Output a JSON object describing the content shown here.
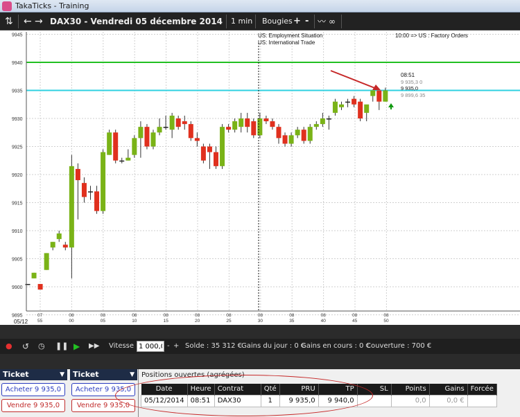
{
  "window": {
    "title": "TakaTicks - Training"
  },
  "toolbar": {
    "refresh_icon": "refresh-icon",
    "instrument_title": "DAX30 - Vendredi 05 décembre 2014",
    "timeframe": "1 min",
    "chart_type": "Bougies",
    "plus": "+",
    "minus": "-"
  },
  "chart": {
    "y_ticks": [
      "9945",
      "9940",
      "9935",
      "9930",
      "9925",
      "9920",
      "9915",
      "9910",
      "9905",
      "9900",
      "9895"
    ],
    "x_ticks": [
      {
        "top": "07",
        "bottom": "55"
      },
      {
        "top": "08",
        "bottom": "00"
      },
      {
        "top": "08",
        "bottom": "05"
      },
      {
        "top": "08",
        "bottom": "10"
      },
      {
        "top": "08",
        "bottom": "15"
      },
      {
        "top": "08",
        "bottom": "20"
      },
      {
        "top": "08",
        "bottom": "25"
      },
      {
        "top": "08",
        "bottom": "30"
      },
      {
        "top": "08",
        "bottom": "35"
      },
      {
        "top": "08",
        "bottom": "40"
      },
      {
        "top": "08",
        "bottom": "45"
      },
      {
        "top": "08",
        "bottom": "50"
      }
    ],
    "date_label": "05/12",
    "event_1": "US: Employment Situation",
    "event_2": "US: International Trade",
    "event_3": "10:00 => US : Factory Orders",
    "time_label": "08:51",
    "quote_1": "9 935,3   0",
    "quote_2": "9 935,0",
    "quote_3": "9 899,6   35"
  },
  "chart_data": {
    "type": "candlestick",
    "instrument": "DAX30",
    "ylim": [
      9895,
      9946
    ],
    "levels": [
      {
        "price": 9940,
        "color": "#22c022"
      },
      {
        "price": 9935,
        "color": "#2fd0e0"
      }
    ],
    "candles": [
      {
        "o": 9900.5,
        "h": 9900.5,
        "l": 9900.5,
        "c": 9900.5
      },
      {
        "o": 9901.5,
        "h": 9902.5,
        "l": 9901.5,
        "c": 9902.5
      },
      {
        "o": 9900.5,
        "h": 9900.5,
        "l": 9899.5,
        "c": 9899.5
      },
      {
        "o": 9903,
        "h": 9906,
        "l": 9903,
        "c": 9906
      },
      {
        "o": 9907,
        "h": 9908,
        "l": 9906.5,
        "c": 9908
      },
      {
        "o": 9908.5,
        "h": 9910,
        "l": 9908,
        "c": 9909.5
      },
      {
        "o": 9907.5,
        "h": 9908,
        "l": 9906.5,
        "c": 9907
      },
      {
        "o": 9907,
        "h": 9923.5,
        "l": 9901.5,
        "c": 9921.5
      },
      {
        "o": 9921,
        "h": 9922,
        "l": 9912,
        "c": 9919
      },
      {
        "o": 9918.5,
        "h": 9919.5,
        "l": 9915,
        "c": 9916
      },
      {
        "o": 9917,
        "h": 9918,
        "l": 9915.5,
        "c": 9917
      },
      {
        "o": 9917,
        "h": 9918,
        "l": 9913,
        "c": 9913.5
      },
      {
        "o": 9913.5,
        "h": 9924.5,
        "l": 9913,
        "c": 9924
      },
      {
        "o": 9923.5,
        "h": 9928,
        "l": 9923.5,
        "c": 9927.5
      },
      {
        "o": 9927.5,
        "h": 9928,
        "l": 9922,
        "c": 9922.5
      },
      {
        "o": 9922.5,
        "h": 9923,
        "l": 9922,
        "c": 9922.5
      },
      {
        "o": 9922.5,
        "h": 9924.5,
        "l": 9922.5,
        "c": 9923
      },
      {
        "o": 9923.5,
        "h": 9927,
        "l": 9923,
        "c": 9926.5
      },
      {
        "o": 9926.5,
        "h": 9929.5,
        "l": 9923,
        "c": 9928.5
      },
      {
        "o": 9928.5,
        "h": 9929,
        "l": 9924.5,
        "c": 9925
      },
      {
        "o": 9925,
        "h": 9928,
        "l": 9924.5,
        "c": 9927.5
      },
      {
        "o": 9927.5,
        "h": 9930,
        "l": 9927,
        "c": 9928.5
      },
      {
        "o": 9928.5,
        "h": 9930.5,
        "l": 9928,
        "c": 9928.5
      },
      {
        "o": 9928,
        "h": 9931,
        "l": 9926.5,
        "c": 9930.5
      },
      {
        "o": 9930,
        "h": 9930.5,
        "l": 9928,
        "c": 9928.5
      },
      {
        "o": 9929.5,
        "h": 9930.5,
        "l": 9928,
        "c": 9929
      },
      {
        "o": 9929,
        "h": 9929.5,
        "l": 9926,
        "c": 9926.5
      },
      {
        "o": 9926.5,
        "h": 9927.5,
        "l": 9925,
        "c": 9926
      },
      {
        "o": 9925,
        "h": 9925.5,
        "l": 9922,
        "c": 9922.5
      },
      {
        "o": 9925,
        "h": 9925.5,
        "l": 9921,
        "c": 9924
      },
      {
        "o": 9924,
        "h": 9925,
        "l": 9921,
        "c": 9921.5
      },
      {
        "o": 9921.5,
        "h": 9929,
        "l": 9921,
        "c": 9928.5
      },
      {
        "o": 9928.5,
        "h": 9929,
        "l": 9927.5,
        "c": 9928
      },
      {
        "o": 9928,
        "h": 9930,
        "l": 9927.5,
        "c": 9929.5
      },
      {
        "o": 9928.5,
        "h": 9931,
        "l": 9927.5,
        "c": 9930
      },
      {
        "o": 9930,
        "h": 9931,
        "l": 9927.5,
        "c": 9928.5
      },
      {
        "o": 9929.5,
        "h": 9930,
        "l": 9926.5,
        "c": 9927
      },
      {
        "o": 9927,
        "h": 9931,
        "l": 9926.5,
        "c": 9930
      },
      {
        "o": 9930,
        "h": 9930.5,
        "l": 9929,
        "c": 9929.5
      },
      {
        "o": 9929.5,
        "h": 9930,
        "l": 9928,
        "c": 9928.5
      },
      {
        "o": 9928.5,
        "h": 9929,
        "l": 9925.5,
        "c": 9926.5
      },
      {
        "o": 9927,
        "h": 9927.5,
        "l": 9925,
        "c": 9925.5
      },
      {
        "o": 9925.5,
        "h": 9927.5,
        "l": 9925,
        "c": 9927
      },
      {
        "o": 9927,
        "h": 9928.5,
        "l": 9926.5,
        "c": 9928
      },
      {
        "o": 9928,
        "h": 9928.5,
        "l": 9925.5,
        "c": 9926
      },
      {
        "o": 9926,
        "h": 9929,
        "l": 9925.5,
        "c": 9928.5
      },
      {
        "o": 9928.5,
        "h": 9929.5,
        "l": 9928,
        "c": 9929
      },
      {
        "o": 9929,
        "h": 9931,
        "l": 9928.5,
        "c": 9930
      },
      {
        "o": 9930,
        "h": 9930.5,
        "l": 9928,
        "c": 9930
      },
      {
        "o": 9931,
        "h": 9933.5,
        "l": 9930.5,
        "c": 9933
      },
      {
        "o": 9932,
        "h": 9933,
        "l": 9931.5,
        "c": 9932.5
      },
      {
        "o": 9933,
        "h": 9933.5,
        "l": 9932,
        "c": 9933
      },
      {
        "o": 9933.5,
        "h": 9934,
        "l": 9932,
        "c": 9932.5
      },
      {
        "o": 9933,
        "h": 9933.5,
        "l": 9929.5,
        "c": 9930
      },
      {
        "o": 9931,
        "h": 9932,
        "l": 9929.5,
        "c": 9932.5
      },
      {
        "o": 9934,
        "h": 9935,
        "l": 9933,
        "c": 9935
      },
      {
        "o": 9935,
        "h": 9935,
        "l": 9931.5,
        "c": 9933
      },
      {
        "o": 9933,
        "h": 9935.5,
        "l": 9933,
        "c": 9935
      }
    ]
  },
  "playbar": {
    "vitesse_label": "Vitesse",
    "vitesse_value": "1 000,0",
    "solde": "Solde : 35 312 €",
    "gains_jour": "Gains du jour : 0 €",
    "gains_cours": "Gains en cours : 0 €",
    "couverture": "Couverture : 700 €"
  },
  "tickets": [
    {
      "head": "Ticket",
      "buy": "Acheter 9 935,0",
      "sell": "Vendre 9 935,0"
    },
    {
      "head": "Ticket",
      "buy": "Acheter 9 935,0",
      "sell": "Vendre 9 935,0"
    }
  ],
  "positions": {
    "title": "Positions ouvertes (agrégées)",
    "columns": [
      "Date",
      "Heure",
      "Contrat",
      "Qté",
      "PRU",
      "TP",
      "SL",
      "Points",
      "Gains",
      "Forcée"
    ],
    "row": {
      "date": "05/12/2014",
      "heure": "08:51",
      "contrat": "DAX30",
      "qte": "1",
      "pru": "9 935,0",
      "tp": "9 940,0",
      "sl": "",
      "points": "0,0",
      "gains": "0,0 €",
      "forcee": ""
    }
  }
}
